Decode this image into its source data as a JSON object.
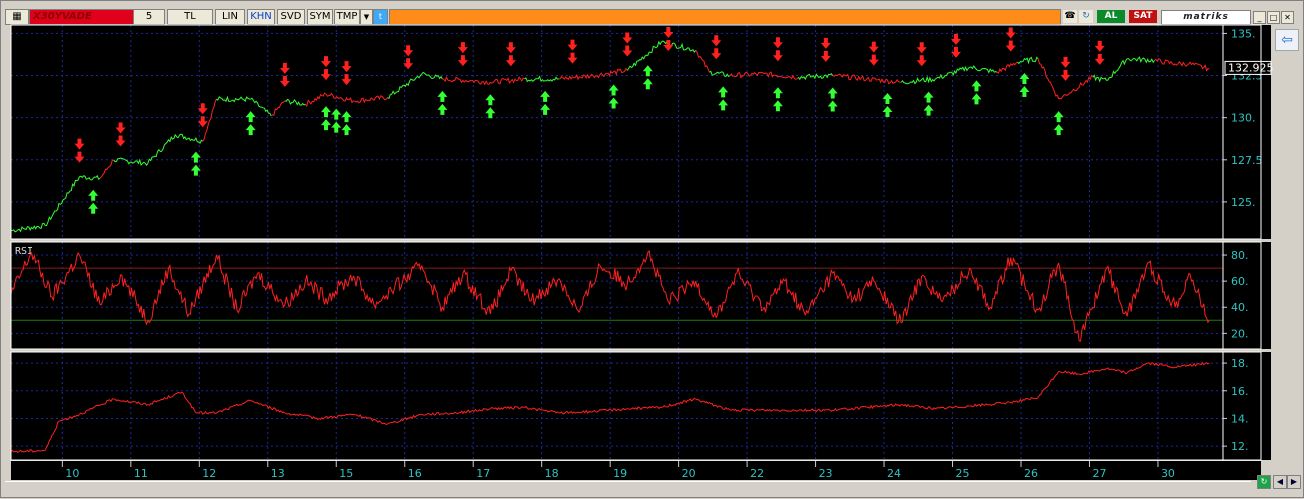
{
  "toolbar": {
    "symbol": "X30YVADE",
    "period": "5",
    "currency": "TL",
    "scale": "LIN",
    "khn": "KHN",
    "svd": "SVD",
    "sym": "SYM",
    "tmp": "TMP",
    "al": "AL",
    "sat": "SAT",
    "brand": "matriks"
  },
  "colors": {
    "background": "#000000",
    "up": "#33ff33",
    "down": "#ff2020",
    "grid": "#1a2aa0",
    "axis_text": "#2ec4c4",
    "rsi_upper": "#8a1a1a",
    "rsi_lower": "#1a7a1a"
  },
  "chart_data": [
    {
      "type": "line",
      "panel": "price",
      "ylim": [
        122.8,
        135.5
      ],
      "yticks": [
        "135.",
        "132.5",
        "130.",
        "127.5",
        "125."
      ],
      "ytick_values": [
        135,
        132.5,
        130,
        127.5,
        125
      ],
      "last_value": "132.925",
      "x_categories": [
        "10",
        "11",
        "12",
        "13",
        "15",
        "16",
        "17",
        "18",
        "19",
        "20",
        "22",
        "23",
        "24",
        "25",
        "26",
        "27",
        "30"
      ],
      "x": [
        0,
        0.5,
        1,
        1.3,
        1.5,
        2,
        2.4,
        2.8,
        3,
        3.5,
        3.8,
        4,
        4.3,
        4.6,
        5,
        5.5,
        6,
        6.3,
        6.7,
        7,
        7.5,
        8,
        8.5,
        9,
        9.5,
        10,
        10.2,
        10.5,
        11,
        11.5,
        12,
        12.5,
        13,
        13.5,
        14,
        14.4,
        14.7,
        15,
        15.3,
        15.5,
        15.8,
        16,
        16.3,
        16.7,
        17,
        17.2,
        17.5
      ],
      "values": [
        123.3,
        123.6,
        126.5,
        126.4,
        127.5,
        127.3,
        129.0,
        128.6,
        131.1,
        131.1,
        130.1,
        131.0,
        130.8,
        131.4,
        131.0,
        131.2,
        132.6,
        132.3,
        132.2,
        132.1,
        132.3,
        132.3,
        132.5,
        132.8,
        134.5,
        134.0,
        132.7,
        132.5,
        132.6,
        132.4,
        132.5,
        132.3,
        132.1,
        132.3,
        133.0,
        132.7,
        133.3,
        133.5,
        131.1,
        131.6,
        132.4,
        132.2,
        133.5,
        133.4,
        133.2,
        133.2,
        132.9
      ],
      "trend": [
        "up",
        "up",
        "up",
        "down",
        "up",
        "up",
        "up",
        "down",
        "up",
        "up",
        "down",
        "up",
        "down",
        "down",
        "down",
        "up",
        "up",
        "down",
        "down",
        "down",
        "up",
        "down",
        "down",
        "up",
        "up",
        "down",
        "up",
        "down",
        "down",
        "up",
        "down",
        "down",
        "up",
        "up",
        "up",
        "down",
        "up",
        "down",
        "down",
        "down",
        "up",
        "up",
        "up",
        "down",
        "down",
        "down",
        "down"
      ],
      "sell_signals_x": [
        1.0,
        1.6,
        2.8,
        4.0,
        4.6,
        4.9,
        5.8,
        6.6,
        7.3,
        8.2,
        9.0,
        9.6,
        10.3,
        11.2,
        11.9,
        12.6,
        13.3,
        13.8,
        14.6,
        15.4,
        15.9
      ],
      "buy_signals_x": [
        1.2,
        2.7,
        3.5,
        4.6,
        4.75,
        4.9,
        6.3,
        7.0,
        7.8,
        8.8,
        9.3,
        10.4,
        11.2,
        12.0,
        12.8,
        13.4,
        14.1,
        14.8,
        15.3
      ]
    },
    {
      "type": "line",
      "panel": "rsi",
      "title": "RSI",
      "ylim": [
        8,
        90
      ],
      "yticks": [
        "80.",
        "60.",
        "40.",
        "20."
      ],
      "ytick_values": [
        80,
        60,
        40,
        20
      ],
      "levels": [
        70,
        30
      ],
      "x": [
        0,
        0.3,
        0.6,
        1,
        1.3,
        1.6,
        2,
        2.3,
        2.6,
        3,
        3.3,
        3.6,
        4,
        4.3,
        4.6,
        5,
        5.3,
        5.6,
        6,
        6.3,
        6.6,
        7,
        7.3,
        7.6,
        8,
        8.3,
        8.6,
        9,
        9.3,
        9.6,
        10,
        10.3,
        10.6,
        11,
        11.3,
        11.6,
        12,
        12.3,
        12.6,
        13,
        13.3,
        13.6,
        14,
        14.3,
        14.6,
        15,
        15.3,
        15.6,
        16,
        16.3,
        16.6,
        17,
        17.2,
        17.5
      ],
      "values": [
        50,
        82,
        48,
        80,
        42,
        65,
        30,
        70,
        35,
        80,
        38,
        66,
        42,
        60,
        47,
        64,
        42,
        55,
        72,
        40,
        66,
        35,
        68,
        45,
        62,
        36,
        72,
        58,
        82,
        44,
        60,
        32,
        66,
        40,
        60,
        34,
        66,
        46,
        60,
        28,
        64,
        44,
        70,
        40,
        78,
        38,
        74,
        14,
        70,
        33,
        74,
        40,
        66,
        30
      ],
      "trend": [
        "down",
        "down",
        "down",
        "down",
        "down",
        "down",
        "down",
        "down",
        "down",
        "down",
        "down",
        "down",
        "down",
        "down",
        "down",
        "down",
        "down",
        "down",
        "down",
        "down",
        "down",
        "down",
        "down",
        "down",
        "down",
        "down",
        "down",
        "down",
        "down",
        "down",
        "down",
        "down",
        "down",
        "down",
        "down",
        "down",
        "down",
        "down",
        "down",
        "down",
        "down",
        "down",
        "down",
        "down",
        "down",
        "down",
        "down",
        "down",
        "down",
        "down",
        "down",
        "down",
        "down",
        "down"
      ]
    },
    {
      "type": "line",
      "panel": "indicator",
      "ylim": [
        11,
        18.8
      ],
      "yticks": [
        "18.",
        "16.",
        "14.",
        "12."
      ],
      "ytick_values": [
        18,
        16,
        14,
        12
      ],
      "x": [
        0,
        0.5,
        0.7,
        1,
        1.5,
        2,
        2.5,
        2.7,
        3,
        3.5,
        4,
        4.5,
        5,
        5.5,
        6,
        6.5,
        7,
        7.5,
        8,
        8.5,
        9,
        9.5,
        10,
        10.5,
        11,
        11.5,
        12,
        12.5,
        13,
        13.5,
        14,
        14.5,
        15,
        15.3,
        15.6,
        16,
        16.3,
        16.6,
        17,
        17.5
      ],
      "values": [
        11.6,
        11.7,
        13.8,
        14.3,
        15.4,
        15.0,
        15.9,
        14.4,
        14.4,
        15.3,
        14.4,
        14.0,
        14.3,
        13.6,
        14.3,
        14.4,
        14.7,
        14.8,
        14.4,
        14.5,
        14.7,
        14.8,
        15.4,
        14.6,
        14.6,
        14.6,
        14.6,
        14.8,
        15.0,
        14.7,
        14.9,
        15.1,
        15.5,
        17.4,
        17.2,
        17.6,
        17.3,
        18.0,
        17.7,
        18.0
      ],
      "trend": [
        "down",
        "down",
        "down",
        "down",
        "down",
        "down",
        "down",
        "down",
        "down",
        "down",
        "down",
        "down",
        "down",
        "down",
        "down",
        "down",
        "down",
        "down",
        "down",
        "down",
        "down",
        "down",
        "down",
        "down",
        "down",
        "down",
        "down",
        "down",
        "down",
        "down",
        "down",
        "down",
        "down",
        "down",
        "down",
        "down",
        "down",
        "down",
        "down",
        "down"
      ]
    }
  ]
}
